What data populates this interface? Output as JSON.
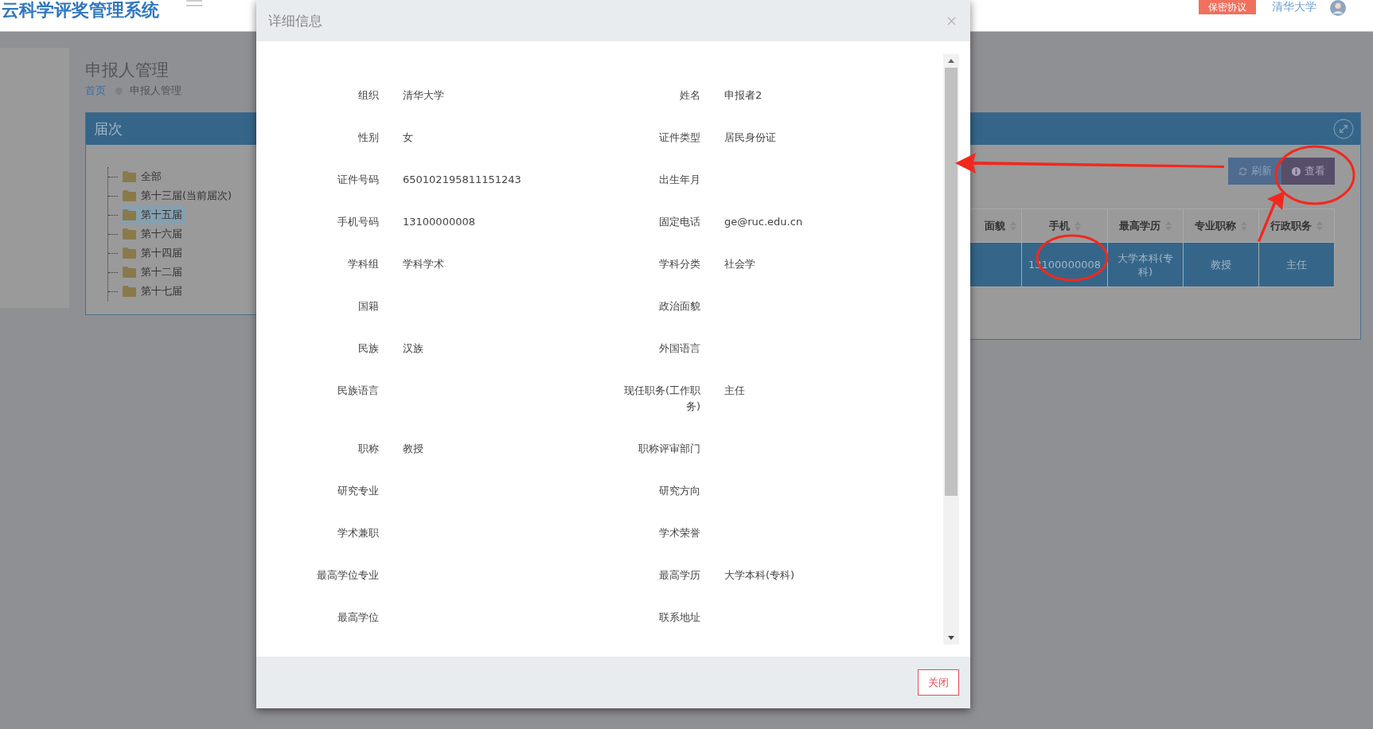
{
  "header": {
    "title": "云科学评奖管理系统",
    "agreement_button": "保密协议",
    "user": "清华大学"
  },
  "page": {
    "title": "申报人管理",
    "breadcrumb": [
      "首页",
      "申报人管理"
    ]
  },
  "tree_panel": {
    "title": "届次",
    "items": [
      {
        "label": "全部",
        "selected": false
      },
      {
        "label": "第十三届(当前届次)",
        "selected": false
      },
      {
        "label": "第十五届",
        "selected": true
      },
      {
        "label": "第十六届",
        "selected": false
      },
      {
        "label": "第十四届",
        "selected": false
      },
      {
        "label": "第十二届",
        "selected": false
      },
      {
        "label": "第十七届",
        "selected": false
      }
    ]
  },
  "table_panel": {
    "toolbar": [
      {
        "label": "刷新",
        "kind": "refresh"
      },
      {
        "label": "查看",
        "kind": "view"
      }
    ],
    "table": {
      "columns": [
        "面貌",
        "手机",
        "最高学历",
        "专业职称",
        "行政职务"
      ],
      "rows": [
        {
          "selected": true,
          "cells": [
            "",
            "13100000008",
            "大学本科(专科)",
            "教授",
            "主任"
          ]
        }
      ]
    }
  },
  "modal": {
    "title": "详细信息",
    "fields": [
      {
        "label": "组织",
        "value": "清华大学"
      },
      {
        "label": "姓名",
        "value": "申报者2"
      },
      {
        "label": "性别",
        "value": "女"
      },
      {
        "label": "证件类型",
        "value": "居民身份证"
      },
      {
        "label": "证件号码",
        "value": "650102195811151243"
      },
      {
        "label": "出生年月"
      },
      {
        "label": "手机号码",
        "value": "13100000008"
      },
      {
        "label": "固定电话",
        "value": "ge@ruc.edu.cn"
      },
      {
        "label": "学科组",
        "value": "学科学术"
      },
      {
        "label": "学科分类",
        "value": "社会学"
      },
      {
        "label": "国籍"
      },
      {
        "label": "政治面貌"
      },
      {
        "label": "民族",
        "value": "汉族"
      },
      {
        "label": "外国语言"
      },
      {
        "label": "民族语言"
      },
      {
        "label": "现任职务(工作职务)",
        "value": "主任"
      },
      {
        "label": "职称",
        "value": "教授"
      },
      {
        "label": "职称评审部门"
      },
      {
        "label": "研究专业"
      },
      {
        "label": "研究方向"
      },
      {
        "label": "学术兼职"
      },
      {
        "label": "学术荣誉"
      },
      {
        "label": "最高学位专业"
      },
      {
        "label": "最高学历",
        "value": "大学本科(专科)"
      },
      {
        "label": "最高学位"
      },
      {
        "label": "联系地址"
      }
    ],
    "close_button": "关闭"
  }
}
